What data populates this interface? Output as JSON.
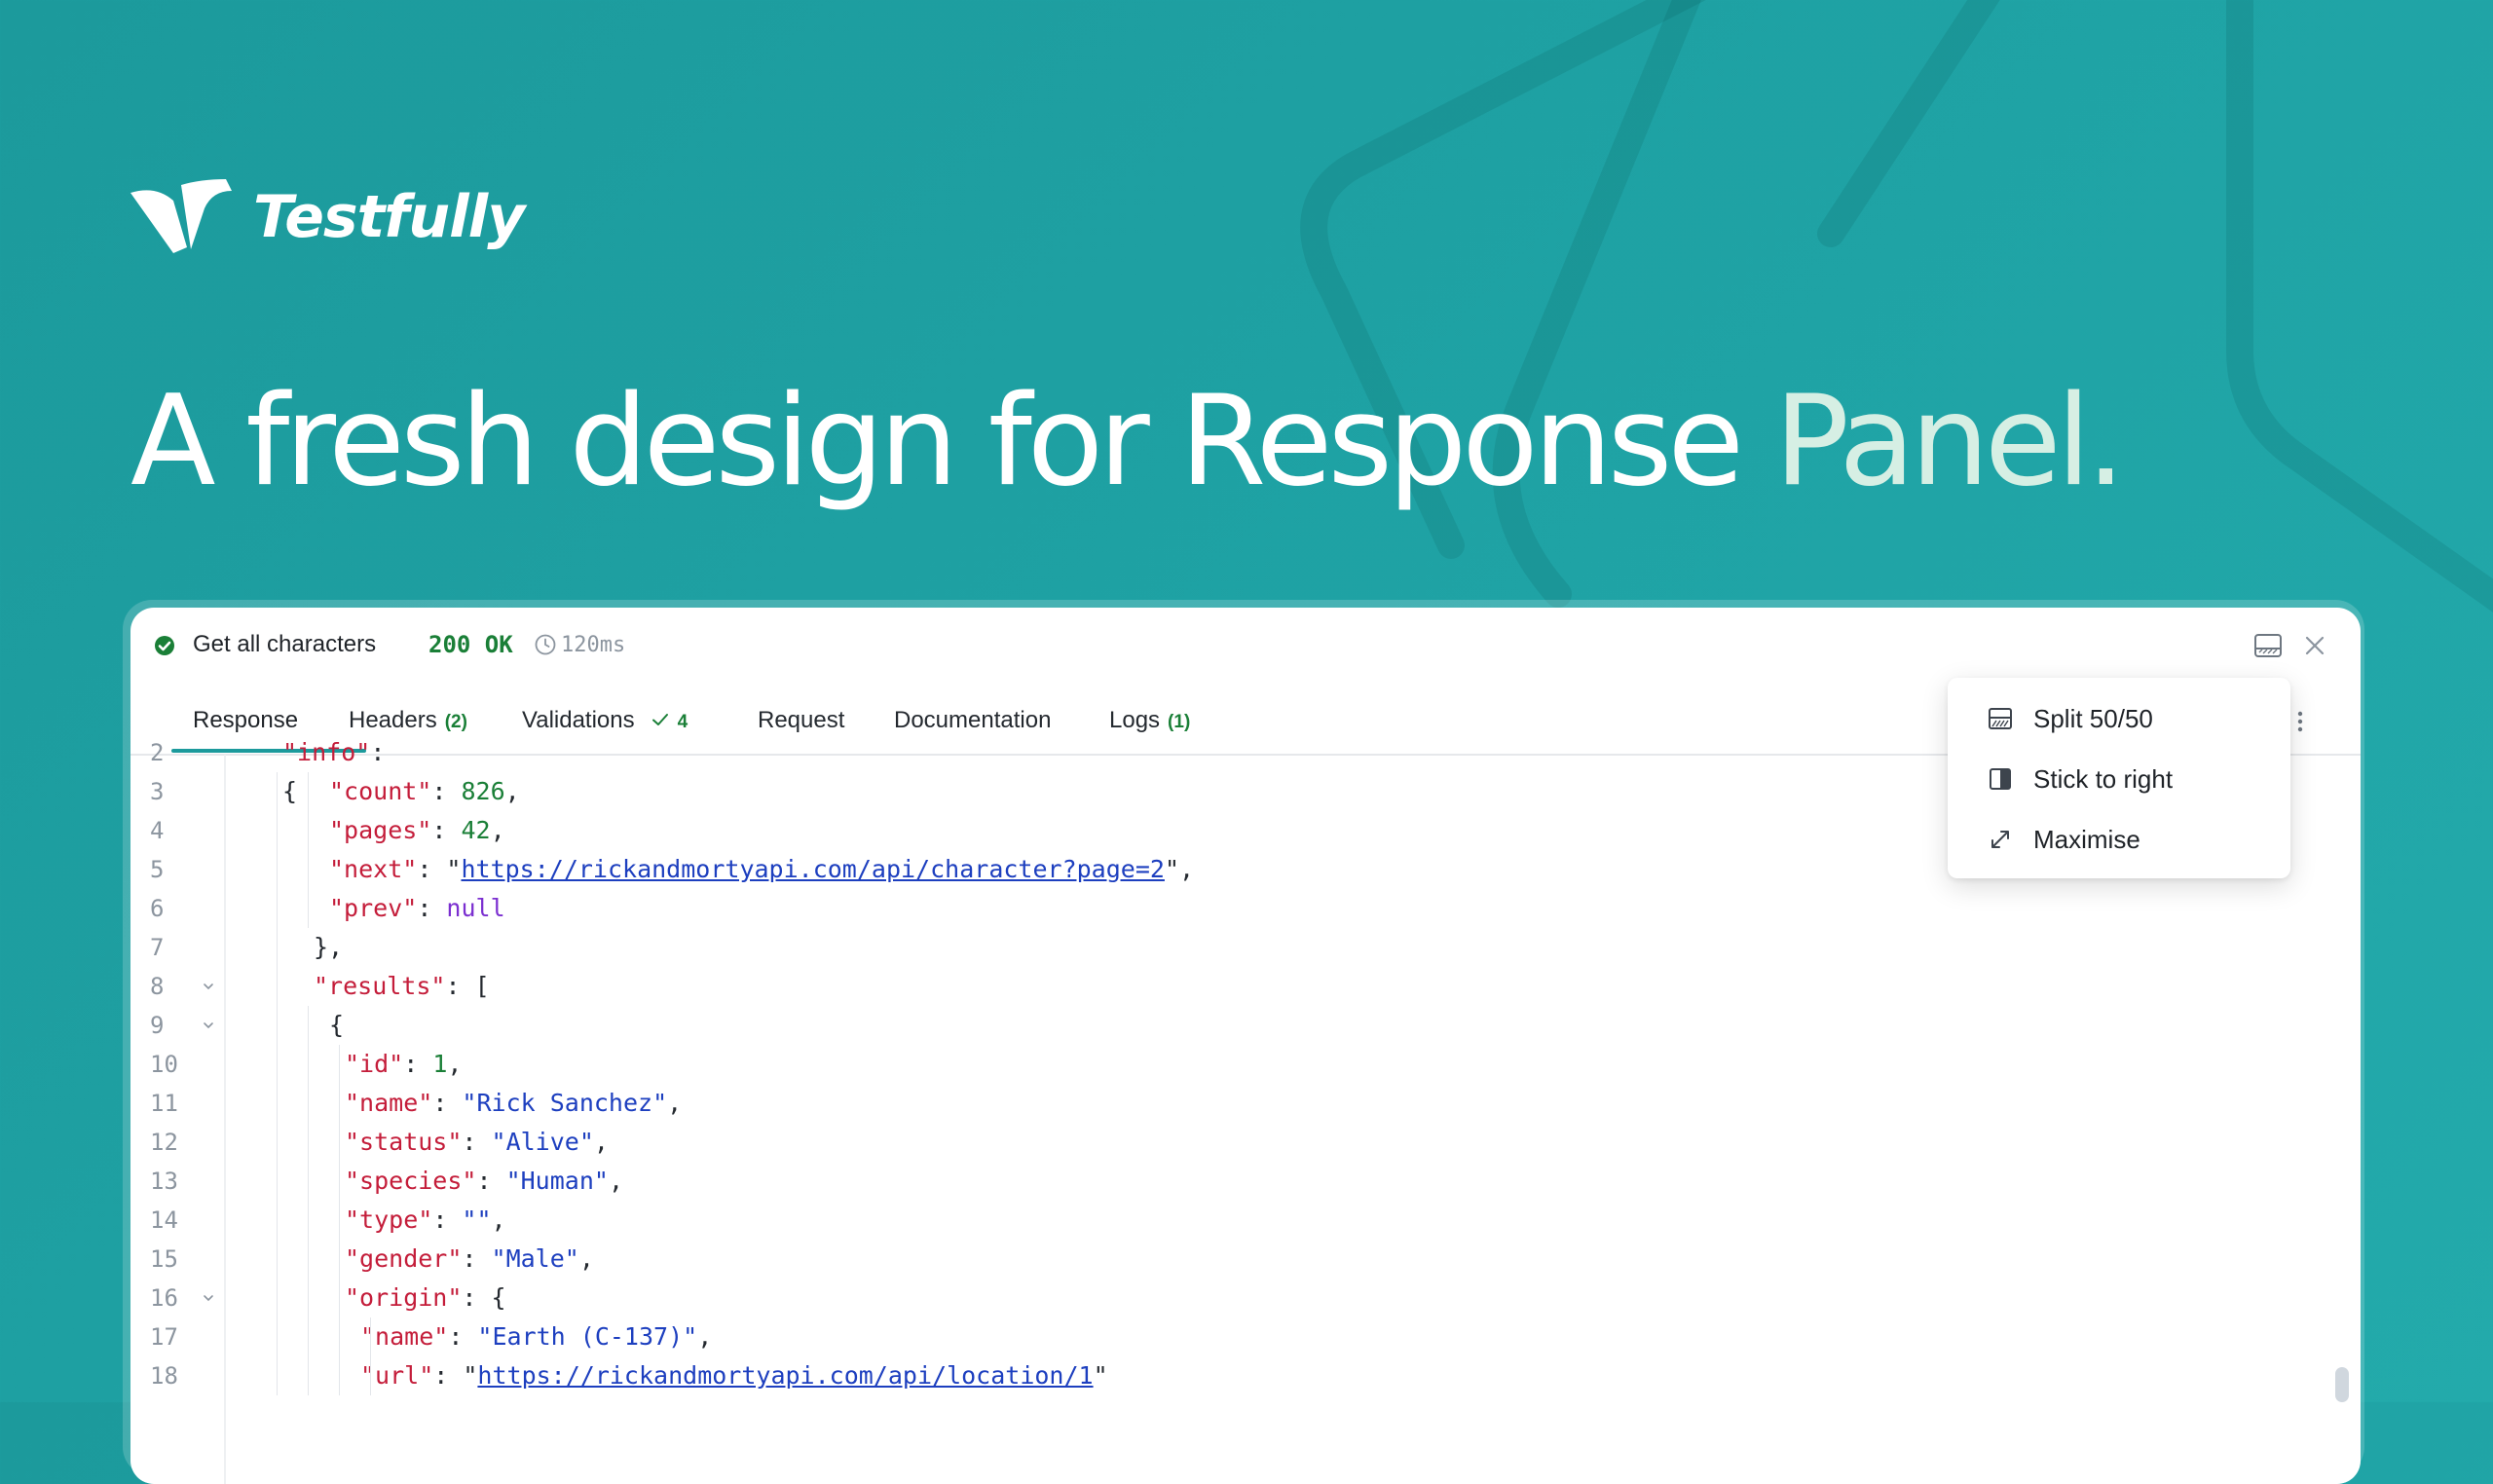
{
  "brand": {
    "name": "Testfully"
  },
  "headline": {
    "main": "A fresh design for Response",
    "fade": " Panel."
  },
  "response_panel": {
    "request_name": "Get all characters",
    "status": "200 OK",
    "timing": "120ms",
    "tabs": [
      {
        "label": "Response"
      },
      {
        "label": "Headers",
        "badge": "(2)"
      },
      {
        "label": "Validations",
        "badge": "4"
      },
      {
        "label": "Request"
      },
      {
        "label": "Documentation"
      },
      {
        "label": "Logs",
        "badge": "(1)"
      }
    ],
    "layout_menu": [
      {
        "label": "Split 50/50",
        "icon": "split-icon"
      },
      {
        "label": "Stick to right",
        "icon": "stick-right-icon"
      },
      {
        "label": "Maximise",
        "icon": "maximise-icon"
      }
    ]
  },
  "code": {
    "lines": [
      {
        "n": "3",
        "key": "\"count\"",
        "sep": ": ",
        "num": "826",
        "tail": ","
      },
      {
        "n": "4",
        "key": "\"pages\"",
        "sep": ": ",
        "num": "42",
        "tail": ","
      },
      {
        "n": "5",
        "key": "\"next\"",
        "sep": ": \"",
        "url": "https://rickandmortyapi.com/api/character?page=2",
        "tail": "\","
      },
      {
        "n": "6",
        "key": "\"prev\"",
        "sep": ": ",
        "nul": "null",
        "tail": ""
      },
      {
        "n": "7",
        "punct": "},",
        "tail": ""
      },
      {
        "n": "8",
        "key": "\"results\"",
        "sep": ": ",
        "punct": "[",
        "tail": "",
        "fold": true
      },
      {
        "n": "9",
        "punct": "{",
        "tail": "",
        "fold": true
      },
      {
        "n": "10",
        "key": "\"id\"",
        "sep": ": ",
        "num": "1",
        "tail": ","
      },
      {
        "n": "11",
        "key": "\"name\"",
        "sep": ": ",
        "str": "\"Rick Sanchez\"",
        "tail": ","
      },
      {
        "n": "12",
        "key": "\"status\"",
        "sep": ": ",
        "str": "\"Alive\"",
        "tail": ","
      },
      {
        "n": "13",
        "key": "\"species\"",
        "sep": ": ",
        "str": "\"Human\"",
        "tail": ","
      },
      {
        "n": "14",
        "key": "\"type\"",
        "sep": ": ",
        "str": "\"\"",
        "tail": ","
      },
      {
        "n": "15",
        "key": "\"gender\"",
        "sep": ": ",
        "str": "\"Male\"",
        "tail": ","
      },
      {
        "n": "16",
        "key": "\"origin\"",
        "sep": ": ",
        "punct": "{",
        "tail": "",
        "fold": true
      },
      {
        "n": "17",
        "key": "\"name\"",
        "sep": ": ",
        "str": "\"Earth (C-137)\"",
        "tail": ","
      },
      {
        "n": "18",
        "key": "\"url\"",
        "sep": ": \"",
        "url": "https://rickandmortyapi.com/api/location/1",
        "tail": "\""
      }
    ],
    "partial_line": {
      "n": "2",
      "key": "\"info\"",
      "sep": ": {"
    }
  },
  "colors": {
    "background": "#1fa3a5",
    "accent": "#1c9a9c",
    "success": "#1a7f37",
    "json_key": "#c41d3a",
    "json_string": "#1d3fbf",
    "json_null": "#7b2fd0"
  }
}
